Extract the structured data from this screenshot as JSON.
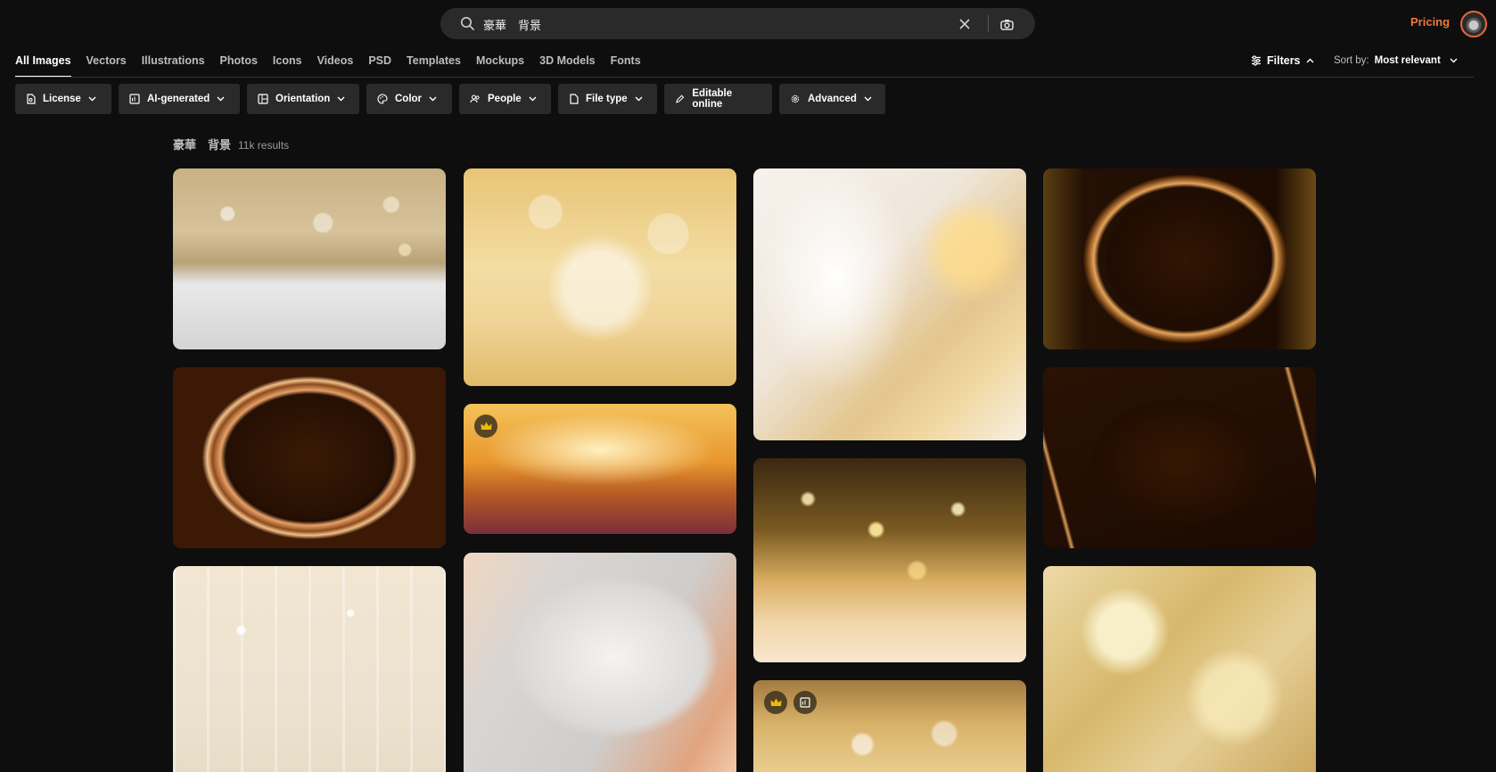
{
  "search": {
    "query": "豪華　背景",
    "placeholder": ""
  },
  "header": {
    "pricing_label": "Pricing"
  },
  "nav": {
    "tabs": [
      {
        "label": "All Images"
      },
      {
        "label": "Vectors"
      },
      {
        "label": "Illustrations"
      },
      {
        "label": "Photos"
      },
      {
        "label": "Icons"
      },
      {
        "label": "Videos"
      },
      {
        "label": "PSD"
      },
      {
        "label": "Templates"
      },
      {
        "label": "Mockups"
      },
      {
        "label": "3D Models"
      },
      {
        "label": "Fonts"
      }
    ],
    "active_tab": "All Images"
  },
  "toolbar": {
    "filters_label": "Filters",
    "sort_by_label": "Sort by:",
    "sort_value": "Most relevant"
  },
  "chips": [
    {
      "label": "License",
      "icon": "license-icon"
    },
    {
      "label": "AI-generated",
      "icon": "ai-icon"
    },
    {
      "label": "Orientation",
      "icon": "orientation-icon"
    },
    {
      "label": "Color",
      "icon": "palette-icon"
    },
    {
      "label": "People",
      "icon": "people-icon"
    },
    {
      "label": "File type",
      "icon": "file-icon"
    },
    {
      "label": "Editable online",
      "icon": "pencil-icon"
    },
    {
      "label": "Advanced",
      "icon": "gear-icon"
    }
  ],
  "results": {
    "query": "豪華　背景",
    "count": "11k results"
  },
  "colors": {
    "background": "#0e0e0e",
    "accent": "#f0773a",
    "chip": "#2a2a2a"
  },
  "images": [
    {
      "id": "gold-bokeh-snow",
      "premium": false,
      "ai": false
    },
    {
      "id": "gold-bokeh-sparkle",
      "premium": false,
      "ai": false
    },
    {
      "id": "white-gold-wave",
      "premium": false,
      "ai": false
    },
    {
      "id": "dark-gold-curve-frame",
      "premium": false,
      "ai": false
    },
    {
      "id": "dark-gold-ring-frame",
      "premium": false,
      "ai": false
    },
    {
      "id": "orange-glitter",
      "premium": true,
      "ai": false
    },
    {
      "id": "dark-gold-stripe-frame",
      "premium": false,
      "ai": false
    },
    {
      "id": "gold-star-bokeh",
      "premium": false,
      "ai": false
    },
    {
      "id": "cream-light-streaks",
      "premium": false,
      "ai": false
    },
    {
      "id": "silver-copper-swirl",
      "premium": false,
      "ai": false
    },
    {
      "id": "gold-bokeh-bottom",
      "premium": true,
      "ai": true
    },
    {
      "id": "gold-polygon-bokeh",
      "premium": false,
      "ai": false
    }
  ]
}
